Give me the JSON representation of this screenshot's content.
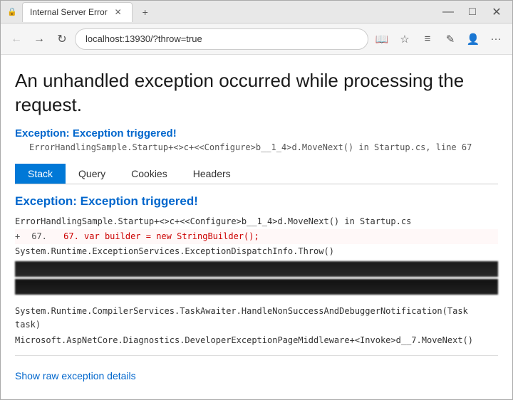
{
  "browser": {
    "title": "Internal Server Error",
    "url": "localhost:13930/?throw=true",
    "new_tab_label": "+",
    "back_icon": "←",
    "forward_icon": "→",
    "refresh_icon": "↻",
    "reader_icon": "📖",
    "star_icon": "☆",
    "menu_icon": "≡",
    "edit_icon": "✎",
    "account_icon": "👤",
    "more_icon": "···"
  },
  "page": {
    "main_heading": "An unhandled exception occurred while processing the request.",
    "exception_label": "Exception: Exception triggered!",
    "exception_location": "ErrorHandlingSample.Startup+<>c+<<Configure>b__1_4>d.MoveNext() in Startup.cs, line 67",
    "tabs": [
      {
        "label": "Stack",
        "active": true
      },
      {
        "label": "Query",
        "active": false
      },
      {
        "label": "Cookies",
        "active": false
      },
      {
        "label": "Headers",
        "active": false
      }
    ],
    "stack_section": {
      "heading": "Exception: Exception triggered!",
      "lines": [
        "ErrorHandlingSample.Startup+<>c+<<Configure>b__1_4>d.MoveNext() in Startup.cs",
        "67.      var builder = new StringBuilder();",
        "System.Runtime.ExceptionServices.ExceptionDispatchInfo.Throw()",
        "",
        "",
        "System.Runtime.CompilerServices.TaskAwaiter.HandleNonSuccessAndDebuggerNotification(Task task)",
        "Microsoft.AspNetCore.Diagnostics.DeveloperExceptionPageMiddleware+<Invoke>d__7.MoveNext()"
      ]
    },
    "show_raw_label": "Show raw exception details"
  }
}
